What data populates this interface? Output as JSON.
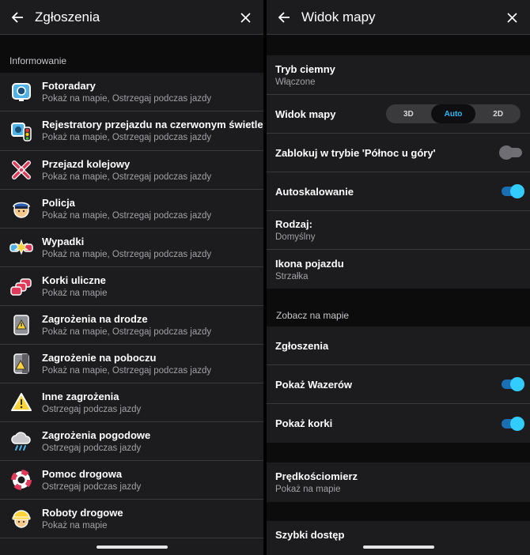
{
  "left": {
    "title": "Zgłoszenia",
    "section": "Informowanie",
    "items": [
      {
        "icon": "speed-camera-icon",
        "title": "Fotoradary",
        "subtitle": "Pokaż na mapie, Ostrzegaj podczas jazdy"
      },
      {
        "icon": "red-light-camera-icon",
        "title": "Rejestratory przejazdu na czerwonym świetle",
        "subtitle": "Pokaż na mapie, Ostrzegaj podczas jazdy"
      },
      {
        "icon": "railroad-crossing-icon",
        "title": "Przejazd kolejowy",
        "subtitle": "Pokaż na mapie, Ostrzegaj podczas jazdy"
      },
      {
        "icon": "police-icon",
        "title": "Policja",
        "subtitle": "Pokaż na mapie, Ostrzegaj podczas jazdy"
      },
      {
        "icon": "crash-icon",
        "title": "Wypadki",
        "subtitle": "Pokaż na mapie, Ostrzegaj podczas jazdy"
      },
      {
        "icon": "traffic-jam-icon",
        "title": "Korki uliczne",
        "subtitle": "Pokaż na mapie"
      },
      {
        "icon": "road-hazard-icon",
        "title": "Zagrożenia na drodze",
        "subtitle": "Pokaż na mapie, Ostrzegaj podczas jazdy"
      },
      {
        "icon": "shoulder-hazard-icon",
        "title": "Zagrożenie na poboczu",
        "subtitle": "Pokaż na mapie, Ostrzegaj podczas jazdy"
      },
      {
        "icon": "warning-icon",
        "title": "Inne zagrożenia",
        "subtitle": "Ostrzegaj podczas jazdy"
      },
      {
        "icon": "weather-icon",
        "title": "Zagrożenia pogodowe",
        "subtitle": "Ostrzegaj podczas jazdy"
      },
      {
        "icon": "lifebuoy-icon",
        "title": "Pomoc drogowa",
        "subtitle": "Ostrzegaj podczas jazdy"
      },
      {
        "icon": "hard-hat-icon",
        "title": "Roboty drogowe",
        "subtitle": "Pokaż na mapie"
      }
    ]
  },
  "right": {
    "title": "Widok mapy",
    "dark_mode": {
      "label": "Tryb ciemny",
      "value": "Włączone"
    },
    "map_view": {
      "label": "Widok mapy",
      "options": [
        "3D",
        "Auto",
        "2D"
      ],
      "selected": "Auto"
    },
    "north_lock": {
      "label": "Zablokuj w trybie 'Północ u góry'",
      "on": false
    },
    "autozoom": {
      "label": "Autoskalowanie",
      "on": true
    },
    "type": {
      "label": "Rodzaj:",
      "value": "Domyślny"
    },
    "vehicle_icon": {
      "label": "Ikona pojazdu",
      "value": "Strzałka"
    },
    "section_map": "Zobacz na mapie",
    "reports": {
      "label": "Zgłoszenia"
    },
    "show_wazers": {
      "label": "Pokaż Wazerów",
      "on": true
    },
    "show_jams": {
      "label": "Pokaż korki",
      "on": true
    },
    "speedometer": {
      "label": "Prędkościomierz",
      "value": "Pokaż na mapie"
    },
    "quick_access": {
      "label": "Szybki dostęp"
    }
  },
  "colors": {
    "accent": "#33ccff",
    "toggle_track": "#1a6fb3",
    "panel": "#1c1c1e",
    "gap": "#0c0c0d"
  }
}
